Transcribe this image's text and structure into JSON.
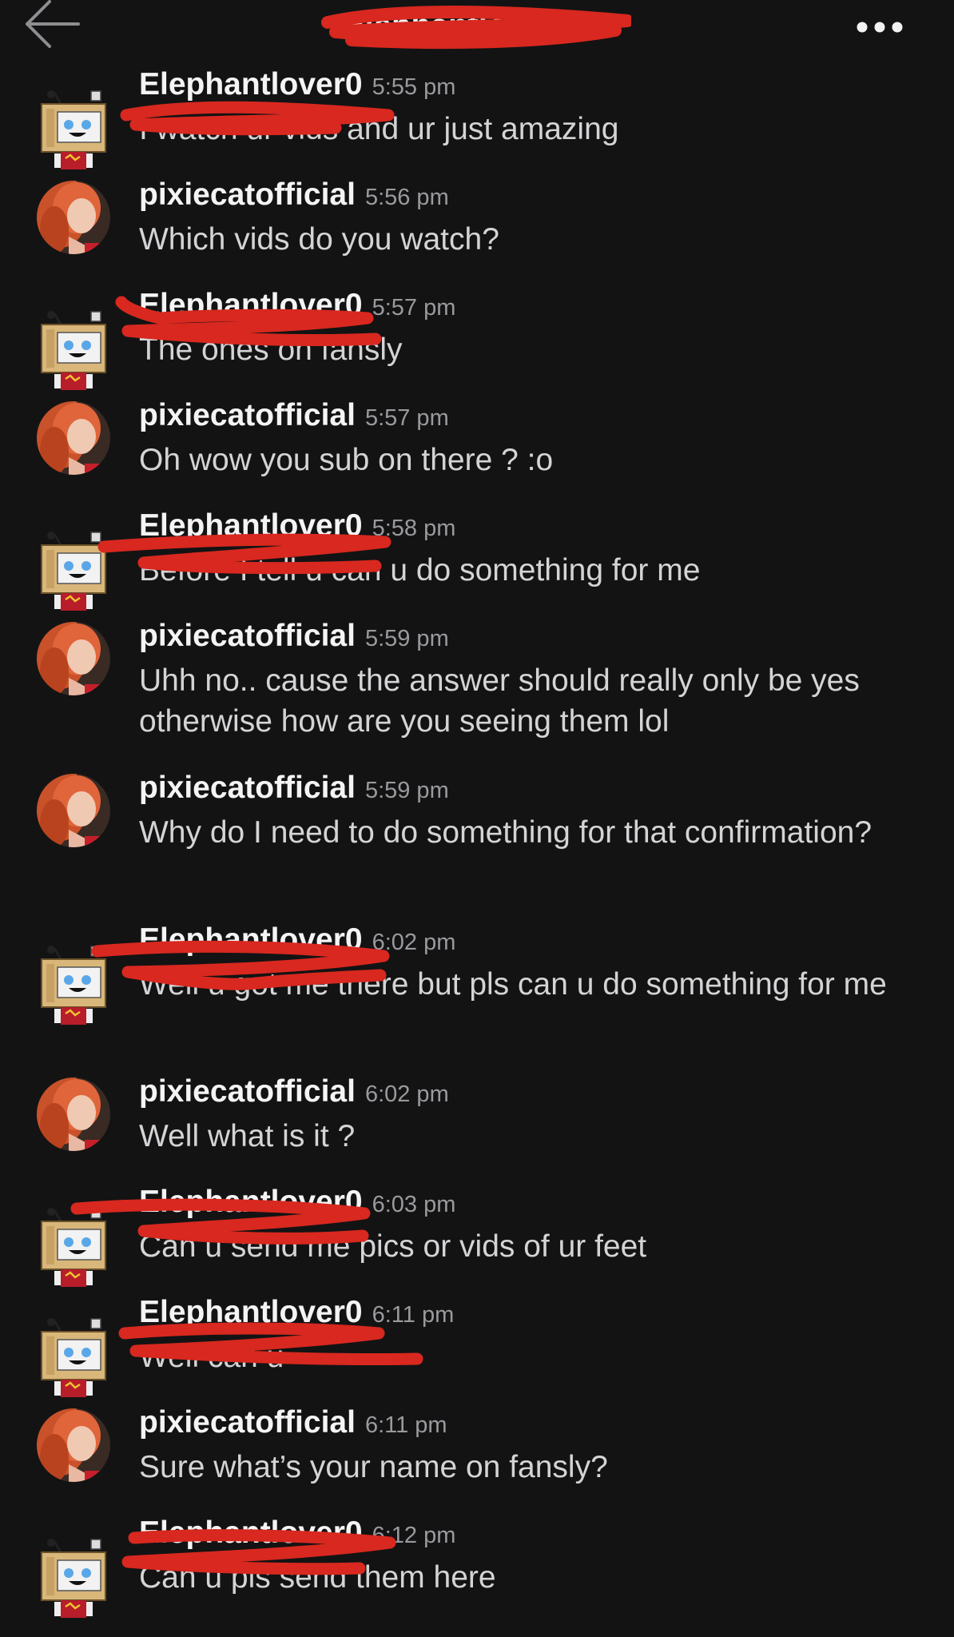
{
  "header": {
    "title": "Elephantlover0",
    "back_icon": "arrow-left-icon",
    "more_icon": "more-horizontal-icon"
  },
  "colors": {
    "background": "#131314",
    "redaction": "#d8281f",
    "text_primary": "#f4f4f5",
    "text_secondary": "#9a9a9e"
  },
  "messages": [
    {
      "sender": "Elephantlover0",
      "time": "5:55 pm",
      "text": "I watch ur vids and ur just amazing"
    },
    {
      "sender": "pixiecatofficial",
      "time": "5:56 pm",
      "text": "Which vids do you watch?"
    },
    {
      "sender": "Elephantlover0",
      "time": "5:57 pm",
      "text": "The ones on fansly"
    },
    {
      "sender": "pixiecatofficial",
      "time": "5:57 pm",
      "text": "Oh wow you sub on there ? :o"
    },
    {
      "sender": "Elephantlover0",
      "time": "5:58 pm",
      "text": "Before I tell u can u do something for me"
    },
    {
      "sender": "pixiecatofficial",
      "time": "5:59 pm",
      "text": "Uhh no.. cause the answer should really only be yes otherwise how are you seeing them lol"
    },
    {
      "sender": "pixiecatofficial",
      "time": "5:59 pm",
      "text": "Why do I need to do something for that confirmation?"
    },
    {
      "sender": "Elephantlover0",
      "time": "6:02 pm",
      "text": "Well u got me there but pls can u do something for me"
    },
    {
      "sender": "pixiecatofficial",
      "time": "6:02 pm",
      "text": "Well what is it ?"
    },
    {
      "sender": "Elephantlover0",
      "time": "6:03 pm",
      "text": "Can u send me pics or vids of ur feet"
    },
    {
      "sender": "Elephantlover0",
      "time": "6:11 pm",
      "text": "Well can u"
    },
    {
      "sender": "pixiecatofficial",
      "time": "6:11 pm",
      "text": "Sure what’s your name on fansly?"
    },
    {
      "sender": "Elephantlover0",
      "time": "6:12 pm",
      "text": "Can u pls send them here"
    }
  ]
}
